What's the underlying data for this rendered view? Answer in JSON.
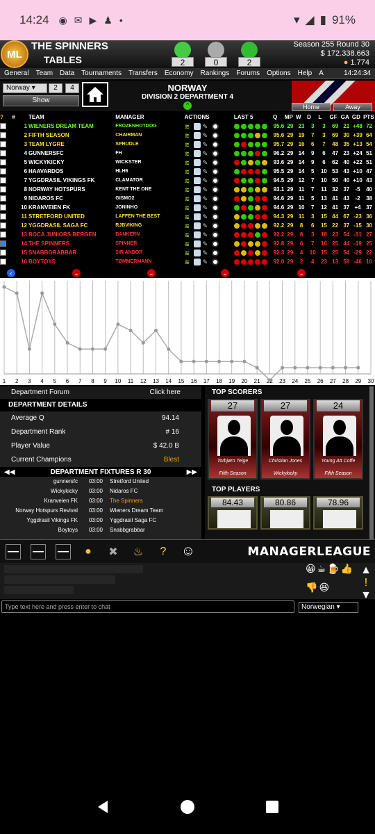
{
  "status": {
    "time": "14:24",
    "battery": "91%"
  },
  "header": {
    "logo": "ML",
    "team_name": "THE SPINNERS",
    "page_name": "TABLES",
    "record": [
      "2",
      "0",
      "2"
    ],
    "season": "Season 255 Round 30",
    "money": "$ 172.338.663",
    "coins": "1.774"
  },
  "menu": {
    "items": [
      "General",
      "Team",
      "Data",
      "Tournaments",
      "Transfers",
      "Economy",
      "Rankings",
      "Forums",
      "Options",
      "Help",
      "A"
    ],
    "clock": "14:24:34"
  },
  "controls": {
    "country_select": "Norway",
    "num1": "2",
    "num2": "4",
    "show": "Show",
    "country": "NORWAY",
    "division": "DIVISION 2 DEPARTMENT 4",
    "home_tab": "Home",
    "away_tab": "Away"
  },
  "table": {
    "headers": {
      "q": "?",
      "pos": "#",
      "team": "TEAM",
      "manager": "MANAGER",
      "actions": "ACTIONS",
      "last5": "LAST 5",
      "qcol": "Q",
      "mp": "MP",
      "w": "W",
      "d": "D",
      "l": "L",
      "gf": "GF",
      "ga": "GA",
      "gd": "GD",
      "pts": "PTS"
    },
    "rows": [
      {
        "pos": "1",
        "team": "WIENERS DREAM TEAM",
        "manager": "FROZENHOTDOG",
        "q": "95.6",
        "mp": "29",
        "w": "23",
        "d": "3",
        "l": "3",
        "gf": "69",
        "ga": "21",
        "gd": "+48",
        "pts": "72",
        "cls": "green",
        "last5": "wwwww",
        "chk": false
      },
      {
        "pos": "2",
        "team": "FIFTH SEASON",
        "manager": "CHAIRMAN",
        "q": "95.6",
        "mp": "29",
        "w": "19",
        "d": "7",
        "l": "3",
        "gf": "69",
        "ga": "30",
        "gd": "+39",
        "pts": "64",
        "cls": "yellow",
        "last5": "wwwdw",
        "chk": false
      },
      {
        "pos": "3",
        "team": "TEAM LYGRE",
        "manager": "SPRUDLE",
        "q": "95.7",
        "mp": "29",
        "w": "16",
        "d": "6",
        "l": "7",
        "gf": "48",
        "ga": "35",
        "gd": "+13",
        "pts": "54",
        "cls": "yellow",
        "last5": "wlwww",
        "chk": false
      },
      {
        "pos": "4",
        "team": "GUNNERSFC",
        "manager": "FH",
        "q": "96.2",
        "mp": "29",
        "w": "14",
        "d": "9",
        "l": "6",
        "gf": "47",
        "ga": "23",
        "gd": "+24",
        "pts": "51",
        "cls": "white",
        "last5": "wwwlw",
        "chk": false
      },
      {
        "pos": "5",
        "team": "WICKYKICKY",
        "manager": "WICKSTER",
        "q": "93.6",
        "mp": "29",
        "w": "14",
        "d": "9",
        "l": "6",
        "gf": "62",
        "ga": "40",
        "gd": "+22",
        "pts": "51",
        "cls": "white",
        "last5": "lwdwd",
        "chk": false
      },
      {
        "pos": "6",
        "team": "HAAVARDOS",
        "manager": "HLH6",
        "q": "95.5",
        "mp": "29",
        "w": "14",
        "d": "5",
        "l": "10",
        "gf": "53",
        "ga": "43",
        "gd": "+10",
        "pts": "47",
        "cls": "white",
        "last5": "wlllw",
        "chk": false
      },
      {
        "pos": "7",
        "team": "YGGDRASIL VIKINGS FK",
        "manager": "CLAMATOR",
        "q": "94.5",
        "mp": "29",
        "w": "12",
        "d": "7",
        "l": "10",
        "gf": "50",
        "ga": "40",
        "gd": "+10",
        "pts": "43",
        "cls": "white",
        "last5": "lwwlw",
        "chk": false
      },
      {
        "pos": "8",
        "team": "NORWAY HOTSPURS",
        "manager": "KENT THE ONE",
        "q": "93.1",
        "mp": "29",
        "w": "11",
        "d": "7",
        "l": "11",
        "gf": "32",
        "ga": "37",
        "gd": "-5",
        "pts": "40",
        "cls": "white",
        "last5": "ddwdd",
        "chk": false
      },
      {
        "pos": "9",
        "team": "NIDAROS FC",
        "manager": "GISMO2",
        "q": "94.6",
        "mp": "29",
        "w": "11",
        "d": "5",
        "l": "13",
        "gf": "41",
        "ga": "43",
        "gd": "-2",
        "pts": "38",
        "cls": "white",
        "last5": "ldwll",
        "chk": false
      },
      {
        "pos": "10",
        "team": "KRANVEIEN FK",
        "manager": "JONINHO",
        "q": "94.6",
        "mp": "29",
        "w": "10",
        "d": "7",
        "l": "12",
        "gf": "41",
        "ga": "37",
        "gd": "+4",
        "pts": "37",
        "cls": "white",
        "last5": "wlwdl",
        "chk": false
      },
      {
        "pos": "11",
        "team": "STRETFORD UNITED",
        "manager": "LAFFEN THE BEST",
        "q": "94.3",
        "mp": "29",
        "w": "11",
        "d": "3",
        "l": "15",
        "gf": "44",
        "ga": "67",
        "gd": "-23",
        "pts": "36",
        "cls": "yellow",
        "last5": "dwwll",
        "chk": false
      },
      {
        "pos": "12",
        "team": "YGGDRASIL SAGA FC",
        "manager": "RJBVIKING",
        "q": "92.2",
        "mp": "29",
        "w": "8",
        "d": "6",
        "l": "15",
        "gf": "22",
        "ga": "37",
        "gd": "-15",
        "pts": "30",
        "cls": "yellow",
        "last5": "dlldd",
        "chk": false
      },
      {
        "pos": "13",
        "team": "BOCA JUNIORS BERGEN",
        "manager": "BANKERN",
        "q": "92.2",
        "mp": "29",
        "w": "8",
        "d": "3",
        "l": "18",
        "gf": "23",
        "ga": "54",
        "gd": "-31",
        "pts": "27",
        "cls": "red",
        "last5": "lllwl",
        "chk": false
      },
      {
        "pos": "14",
        "team": "THE SPINNERS",
        "manager": "SPINNER",
        "q": "92.8",
        "mp": "29",
        "w": "6",
        "d": "7",
        "l": "16",
        "gf": "25",
        "ga": "44",
        "gd": "-19",
        "pts": "25",
        "cls": "red",
        "last5": "dlddl",
        "chk": true
      },
      {
        "pos": "15",
        "team": "SNABBGRABBAR",
        "manager": "SIR ANDOR",
        "q": "92.3",
        "mp": "29",
        "w": "4",
        "d": "10",
        "l": "15",
        "gf": "25",
        "ga": "54",
        "gd": "-29",
        "pts": "22",
        "cls": "red",
        "last5": "ldldl",
        "chk": false
      },
      {
        "pos": "16",
        "team": "BOYTOYS",
        "manager": "TØMMERMANN",
        "q": "92.0",
        "mp": "29",
        "w": "2",
        "d": "4",
        "l": "23",
        "gf": "13",
        "ga": "59",
        "gd": "-46",
        "pts": "10",
        "cls": "red",
        "last5": "lllll",
        "chk": false
      }
    ]
  },
  "chart_data": {
    "type": "line",
    "title": "",
    "x": [
      1,
      2,
      3,
      4,
      5,
      6,
      7,
      8,
      9,
      10,
      11,
      12,
      13,
      14,
      15,
      16,
      17,
      18,
      19,
      20,
      21,
      22,
      23,
      24,
      25,
      26,
      27,
      28,
      29,
      30
    ],
    "values": [
      2,
      3,
      12,
      3,
      8,
      11,
      12,
      12,
      12,
      8,
      9,
      11,
      9,
      12,
      14,
      14,
      14,
      14,
      14,
      14,
      15,
      17,
      15,
      15,
      15,
      15,
      15,
      15,
      15
    ],
    "ylim": [
      1,
      16
    ],
    "grid": true
  },
  "department": {
    "forum_label": "Department Forum",
    "forum_link": "Click here",
    "details_title": "DEPARTMENT DETAILS",
    "details": [
      {
        "label": "Average Q",
        "value": "94.14"
      },
      {
        "label": "Department Rank",
        "value": "# 16"
      },
      {
        "label": "Player Value",
        "value": "$ 42.0 B"
      },
      {
        "label": "Current Champions",
        "value": "Blest"
      }
    ],
    "fixtures_title": "DEPARTMENT FIXTURES R 30",
    "fixtures": [
      {
        "home": "gunnersfc",
        "time": "03:00",
        "away": "Stretford United"
      },
      {
        "home": "Wickykicky",
        "time": "03:00",
        "away": "Nidaros FC"
      },
      {
        "home": "Kranveien FK",
        "time": "03:00",
        "away": "The Spinners"
      },
      {
        "home": "Norway Hotspurs Revival",
        "time": "03:00",
        "away": "Wieners Dream Team"
      },
      {
        "home": "Yggdrasil Vikings FK",
        "time": "03:00",
        "away": "Yggdrasil Saga FC"
      },
      {
        "home": "Boytoys",
        "time": "03:00",
        "away": "Snabbgrabbar"
      }
    ]
  },
  "scorers": {
    "title": "TOP SCORERS",
    "cards": [
      {
        "score": "27",
        "name": "Torbjørn Teige",
        "team": "Fifth Season"
      },
      {
        "score": "27",
        "name": "Christian Jones",
        "team": "Wickykicky"
      },
      {
        "score": "24",
        "name": "Young Att Coffe",
        "team": "Fifth Season"
      }
    ],
    "players_title": "TOP PLAYERS",
    "players": [
      "84.43",
      "80.86",
      "78.96"
    ]
  },
  "toolbar": {
    "brand": "MANAGERLEAGUE"
  },
  "chat": {
    "placeholder": "Type text here and press enter to chat",
    "language": "Norwegian"
  }
}
